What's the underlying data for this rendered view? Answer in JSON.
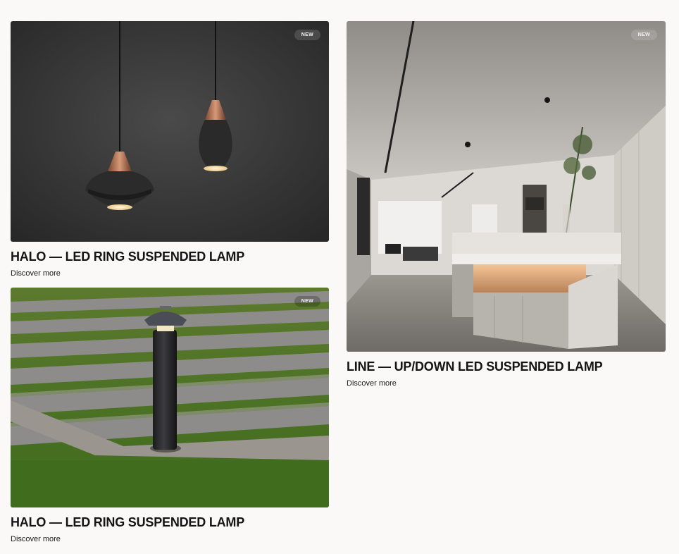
{
  "products": [
    {
      "title": "HALO — LED RING SUSPENDED LAMP",
      "badge": "NEW",
      "link_label": "Discover more",
      "image": "pendant-lamps-photo"
    },
    {
      "title": "LINE — UP/DOWN LED SUSPENDED LAMP",
      "badge": "NEW",
      "link_label": "Discover more",
      "image": "kitchen-island-interior-photo"
    },
    {
      "title": "HALO — LED RING SUSPENDED LAMP",
      "badge": "NEW",
      "link_label": "Discover more",
      "image": "garden-bollard-lamp-photo"
    }
  ]
}
